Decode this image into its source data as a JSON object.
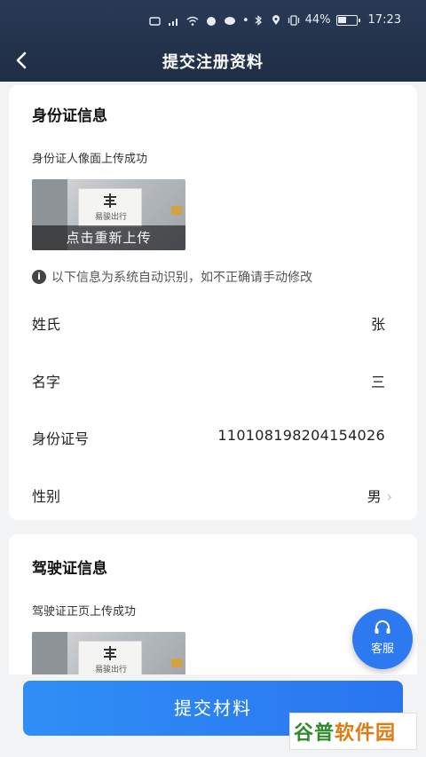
{
  "status_bar": {
    "battery": "44%",
    "time": "17:23"
  },
  "nav": {
    "title": "提交注册资料"
  },
  "id_card": {
    "section_title": "身份证信息",
    "upload_label": "身份证人像面上传成功",
    "thumb_sign_text": "易骏出行",
    "reupload_label": "点击重新上传",
    "notice": "以下信息为系统自动识别，如不正确请手动修改",
    "fields": [
      {
        "label": "姓氏",
        "value": "张"
      },
      {
        "label": "名字",
        "value": "三"
      },
      {
        "label": "身份证号",
        "value": "110108198204154026"
      },
      {
        "label": "性别",
        "value": "男"
      }
    ]
  },
  "driver_license": {
    "section_title": "驾驶证信息",
    "upload_label": "驾驶证正页上传成功",
    "thumb_sign_text": "易骏出行"
  },
  "customer_service": {
    "label": "客服"
  },
  "submit": {
    "label": "提交材料"
  },
  "watermark": {
    "part1": "谷普",
    "part2": "软件园"
  },
  "colors": {
    "header": "#1f2d45",
    "primary": "#2a75ef",
    "service": "#2c79f0"
  }
}
